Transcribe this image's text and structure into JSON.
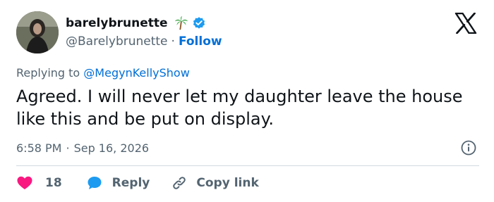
{
  "author": {
    "display_name": "barelybrunette",
    "handle": "@Barelybrunette",
    "separator": "·",
    "follow_label": "Follow",
    "verified_color": "#1d9bf0"
  },
  "tweet": {
    "replying_prefix": "Replying to",
    "replying_to": "@MegynKellyShow",
    "text": "Agreed. I will never let my daughter leave the house like this and be put on display.",
    "time": "6:58 PM",
    "meta_separator": "·",
    "date": "Sep 16, 2026"
  },
  "actions": {
    "like_count": "18",
    "reply_label": "Reply",
    "copy_link_label": "Copy link",
    "like_color": "#f91880",
    "reply_color": "#1d9bf0"
  },
  "icons": [
    "palm-tree-icon",
    "verified-badge-icon",
    "x-logo-icon",
    "info-icon",
    "heart-icon",
    "reply-bubble-icon",
    "link-icon"
  ]
}
